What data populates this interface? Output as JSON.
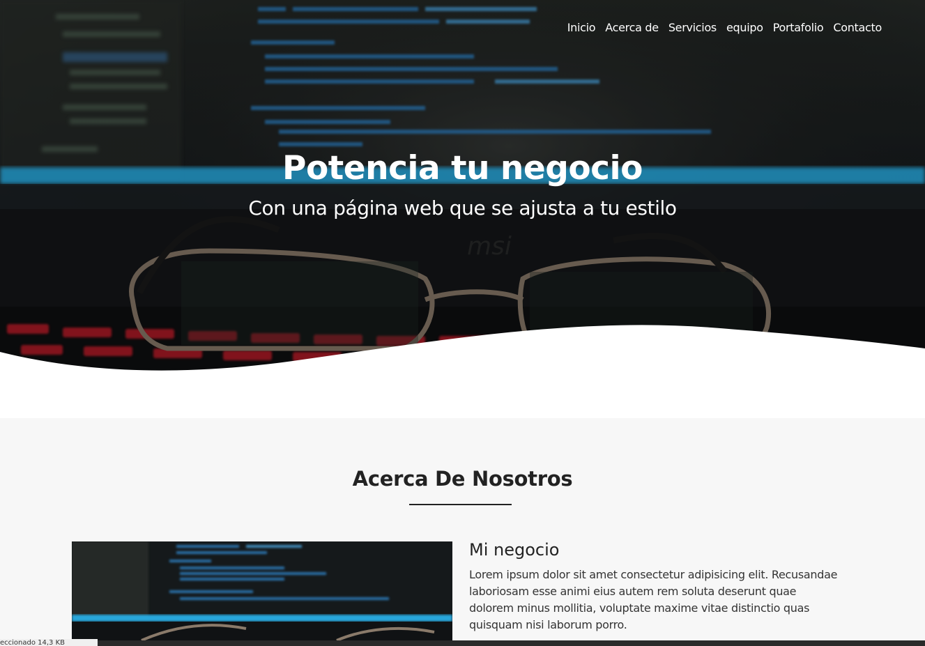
{
  "nav": {
    "items": [
      {
        "label": "Inicio"
      },
      {
        "label": "Acerca de"
      },
      {
        "label": "Servicios"
      },
      {
        "label": "equipo"
      },
      {
        "label": "Portafolio"
      },
      {
        "label": "Contacto"
      }
    ]
  },
  "hero": {
    "title": "Potencia tu negocio",
    "subtitle": "Con una página web que se ajusta a tu estilo",
    "photo_icon": "code-screen-with-glasses-photo"
  },
  "about": {
    "title": "Acerca De Nosotros",
    "card_heading": "Mi negocio",
    "card_text": "Lorem ipsum dolor sit amet consectetur adipisicing elit. Recusandae laboriosam esse animi eius autem rem soluta deserunt quae dolorem minus mollitia, voluptate maxime vitae distinctio quas quisquam nisi laborum porro.",
    "image_icon": "code-screen-photo"
  },
  "status": {
    "text": "eccionado 14,3 KB"
  },
  "colors": {
    "code_blue": "#29a8e0",
    "keyboard_red": "#d8232f",
    "section_bg": "#f7f7f7"
  }
}
